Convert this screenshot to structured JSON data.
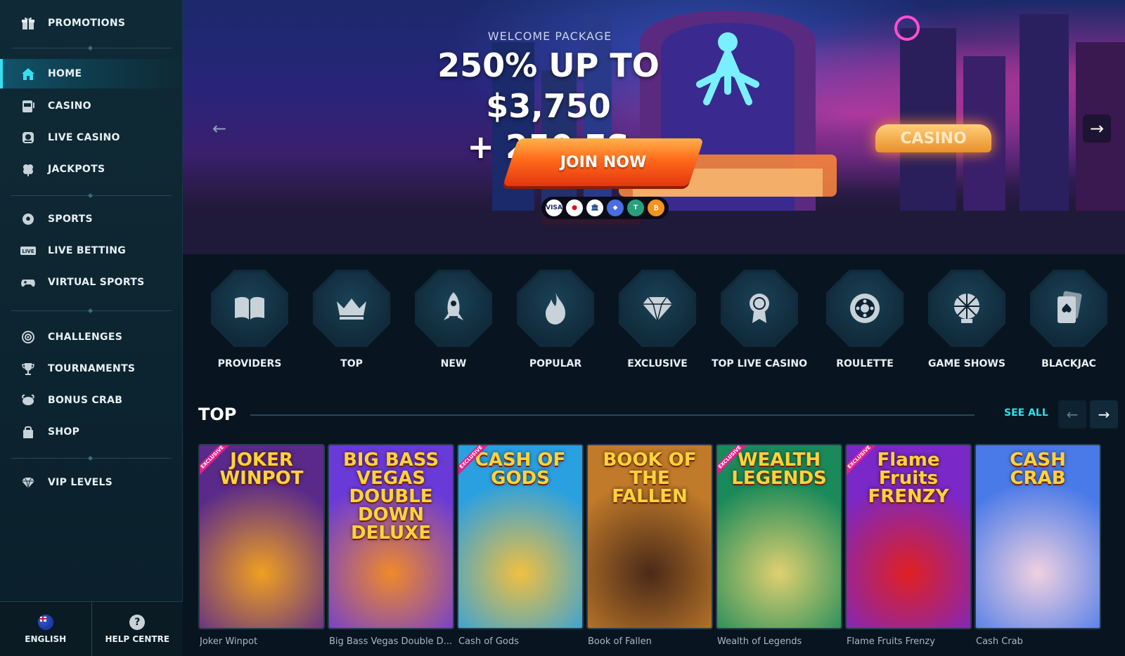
{
  "sidebar": {
    "items": [
      {
        "label": "PROMOTIONS",
        "icon": "gift-icon"
      },
      {
        "label": "HOME",
        "icon": "home-icon",
        "active": true
      },
      {
        "label": "CASINO",
        "icon": "slot-machine-icon"
      },
      {
        "label": "LIVE CASINO",
        "icon": "live-dealer-icon"
      },
      {
        "label": "JACKPOTS",
        "icon": "clover-icon"
      },
      {
        "label": "SPORTS",
        "icon": "soccer-ball-icon"
      },
      {
        "label": "LIVE BETTING",
        "icon": "live-badge-icon"
      },
      {
        "label": "VIRTUAL SPORTS",
        "icon": "gamepad-icon"
      },
      {
        "label": "CHALLENGES",
        "icon": "target-icon"
      },
      {
        "label": "TOURNAMENTS",
        "icon": "trophy-icon"
      },
      {
        "label": "BONUS CRAB",
        "icon": "crab-icon"
      },
      {
        "label": "SHOP",
        "icon": "shop-bag-icon"
      },
      {
        "label": "VIP LEVELS",
        "icon": "diamond-icon"
      }
    ],
    "footer": {
      "language": "ENGLISH",
      "help": "HELP CENTRE",
      "help_glyph": "?"
    }
  },
  "hero": {
    "tag": "WELCOME PACKAGE",
    "title_line1": "250% UP TO $3,750",
    "title_line2": "+ 250 FS",
    "cta": "JOIN NOW",
    "sign": "CASINO",
    "payments": [
      {
        "label": "VISA",
        "bg": "#ffffff",
        "fg": "#1a1f71"
      },
      {
        "label": "●",
        "bg": "#ffffff",
        "fg": "#eb001b"
      },
      {
        "label": "🏛",
        "bg": "#ffffff",
        "fg": "#1a4d8f"
      },
      {
        "label": "◆",
        "bg": "#4a6ee0",
        "fg": "#ffffff"
      },
      {
        "label": "T",
        "bg": "#26a17b",
        "fg": "#ffffff"
      },
      {
        "label": "₿",
        "bg": "#f7931a",
        "fg": "#ffffff"
      }
    ]
  },
  "categories": [
    {
      "label": "PROVIDERS",
      "icon": "open-book-icon"
    },
    {
      "label": "TOP",
      "icon": "crown-icon"
    },
    {
      "label": "NEW",
      "icon": "rocket-icon"
    },
    {
      "label": "POPULAR",
      "icon": "flame-icon"
    },
    {
      "label": "EXCLUSIVE",
      "icon": "diamond-icon"
    },
    {
      "label": "TOP LIVE CASINO",
      "icon": "award-badge-icon"
    },
    {
      "label": "ROULETTE",
      "icon": "roulette-icon"
    },
    {
      "label": "GAME SHOWS",
      "icon": "wheel-icon"
    },
    {
      "label": "BLACKJAC",
      "icon": "playing-card-icon"
    }
  ],
  "top_section": {
    "title": "TOP",
    "see_all": "SEE ALL",
    "games": [
      {
        "caption": "Joker Winpot",
        "art_title": "JOKER WINPOT",
        "exclusive": true,
        "bg1": "#5a2a8a",
        "bg2": "#f0a020"
      },
      {
        "caption": "Big Bass Vegas Double D...",
        "art_title": "BIG BASS VEGAS DOUBLE DOWN DELUXE",
        "exclusive": false,
        "bg1": "#6a3ad8",
        "bg2": "#f08a2a"
      },
      {
        "caption": "Cash of Gods",
        "art_title": "CASH OF GODS",
        "exclusive": true,
        "bg1": "#2aa0e0",
        "bg2": "#f0c040"
      },
      {
        "caption": "Book of Fallen",
        "art_title": "BOOK OF THE FALLEN",
        "exclusive": false,
        "bg1": "#c07a2a",
        "bg2": "#4a2a18"
      },
      {
        "caption": "Wealth of Legends",
        "art_title": "WEALTH LEGENDS",
        "exclusive": true,
        "bg1": "#1a8a5a",
        "bg2": "#e0d070"
      },
      {
        "caption": "Flame Fruits Frenzy",
        "art_title": "Flame Fruits FRENZY",
        "exclusive": true,
        "bg1": "#7a28c8",
        "bg2": "#e02020"
      },
      {
        "caption": "Cash Crab",
        "art_title": "CASH CRAB",
        "exclusive": false,
        "bg1": "#4a7ae8",
        "bg2": "#f0d0e0"
      }
    ]
  },
  "colors": {
    "accent": "#2ee0ea",
    "cta": "#ff6a1a",
    "bg": "#081520",
    "sidebar": "#0f2a36"
  }
}
